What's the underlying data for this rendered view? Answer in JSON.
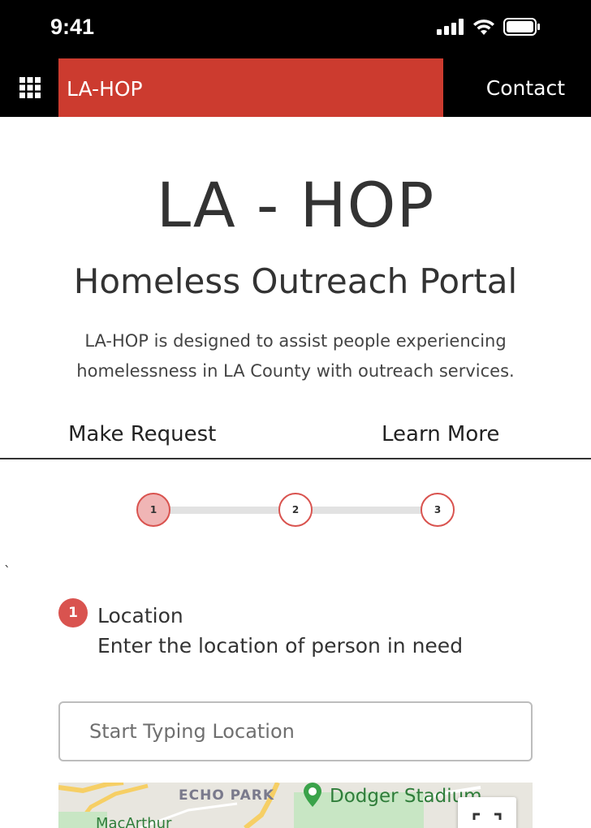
{
  "status_bar": {
    "time": "9:41",
    "icons": [
      "signal-icon",
      "wifi-icon",
      "battery-icon"
    ]
  },
  "nav": {
    "menu_icon": "apps-grid-icon",
    "brand": "LA-HOP",
    "contact": "Contact"
  },
  "hero": {
    "title": "LA - HOP",
    "subtitle": "Homeless Outreach Portal",
    "description": "LA-HOP is designed to assist people experiencing homelessness in LA County with outreach services."
  },
  "tabs": {
    "make_request": "Make Request",
    "learn_more": "Learn More"
  },
  "stepper": {
    "steps": [
      "1",
      "2",
      "3"
    ],
    "active_step": 1
  },
  "stray_mark": "`",
  "location_section": {
    "number": "1",
    "title": "Location",
    "description": "Enter the location of person in need",
    "input_placeholder": "Start Typing Location",
    "input_value": ""
  },
  "map": {
    "labels": {
      "echo_park": "ECHO PARK",
      "dodger_stadium": "Dodger Stadium",
      "macarthur": "MacArthur"
    },
    "fullscreen_icon": "fullscreen-icon"
  },
  "colors": {
    "brand_red": "#cc3b2f",
    "step_red": "#d9534f",
    "step_active_fill": "#f0b5b5",
    "nav_bg": "#000000"
  }
}
